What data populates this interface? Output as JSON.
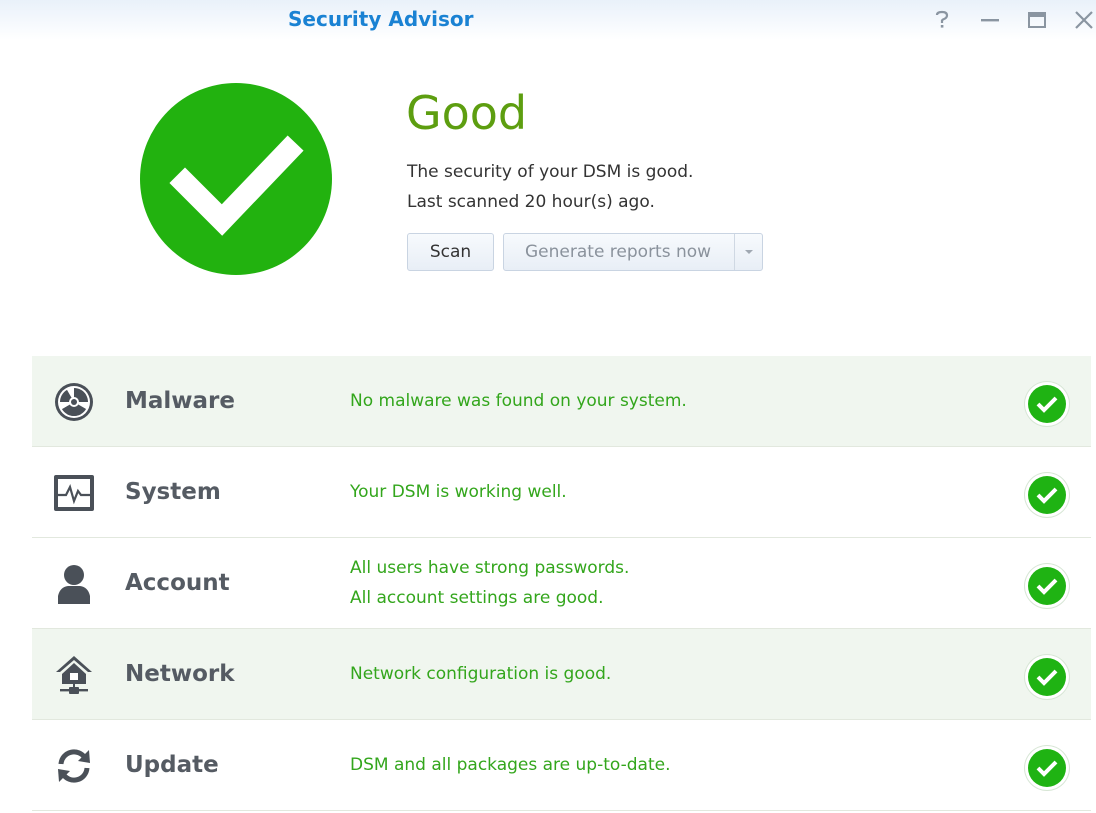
{
  "window": {
    "title": "Security Advisor",
    "controls": [
      "help-icon",
      "minimize-icon",
      "maximize-icon",
      "close-icon"
    ]
  },
  "status": {
    "icon": "checkmark-icon",
    "color": "#22b20f",
    "title": "Good",
    "title_color": "#5d9e10",
    "description": "The security of your DSM is good.",
    "last_scanned": "Last scanned 20 hour(s) ago."
  },
  "actions": {
    "scan_label": "Scan",
    "generate_label": "Generate reports now"
  },
  "categories": [
    {
      "label": "Malware",
      "icon": "radiation-icon",
      "messages": [
        "No malware was found on your system."
      ],
      "status": "ok"
    },
    {
      "label": "System",
      "icon": "system-monitor-icon",
      "messages": [
        "Your DSM is working well."
      ],
      "status": "ok"
    },
    {
      "label": "Account",
      "icon": "user-icon",
      "messages": [
        "All users have strong passwords.",
        "All account settings are good."
      ],
      "status": "ok"
    },
    {
      "label": "Network",
      "icon": "network-home-icon",
      "messages": [
        "Network configuration is good."
      ],
      "status": "ok"
    },
    {
      "label": "Update",
      "icon": "refresh-icon",
      "messages": [
        "DSM and all packages are up-to-date."
      ],
      "status": "ok"
    }
  ],
  "colors": {
    "accent": "#1a82d3",
    "ok_green": "#1fb313",
    "message_green": "#33a61c"
  }
}
